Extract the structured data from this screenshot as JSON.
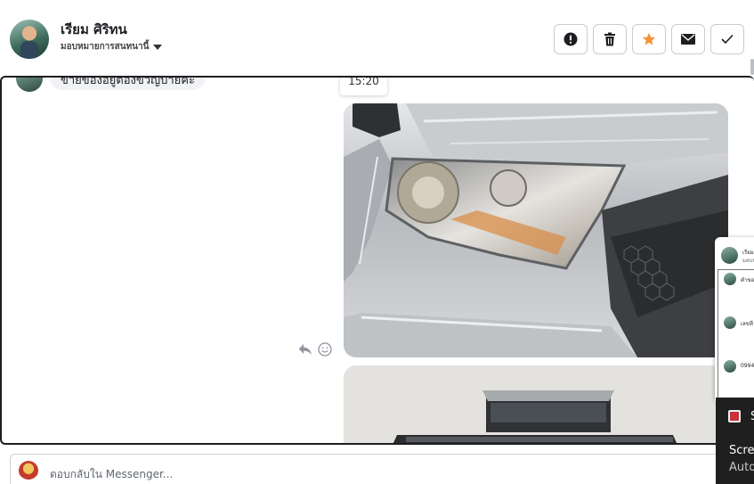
{
  "header": {
    "contact_name": "เรียม ศิริทน",
    "assign_label": "มอบหมายการสนทนานี้",
    "actions": [
      {
        "name": "mark-spam-button",
        "icon": "exclamation-icon"
      },
      {
        "name": "delete-button",
        "icon": "trash-icon"
      },
      {
        "name": "star-button",
        "icon": "star-icon"
      },
      {
        "name": "mark-unread-button",
        "icon": "envelope-icon"
      },
      {
        "name": "mark-done-button",
        "icon": "check-icon"
      }
    ],
    "star_color": "#f7923a"
  },
  "conversation": {
    "previous_message": "ขายของอยู่ต้องขวัญบายค่ะ",
    "timestamp": "15:20",
    "message_tools": [
      "reply-icon",
      "emoji-icon"
    ]
  },
  "popout": {
    "title": "เรียม",
    "subtitle": "มอบหม",
    "items": [
      "คำขอ",
      "เลขที่",
      "0994"
    ]
  },
  "toast": {
    "app_initial": "S",
    "line1": "Screen",
    "line2": "Autos"
  },
  "reply": {
    "placeholder": "ตอบกลับใน Messenger..."
  }
}
